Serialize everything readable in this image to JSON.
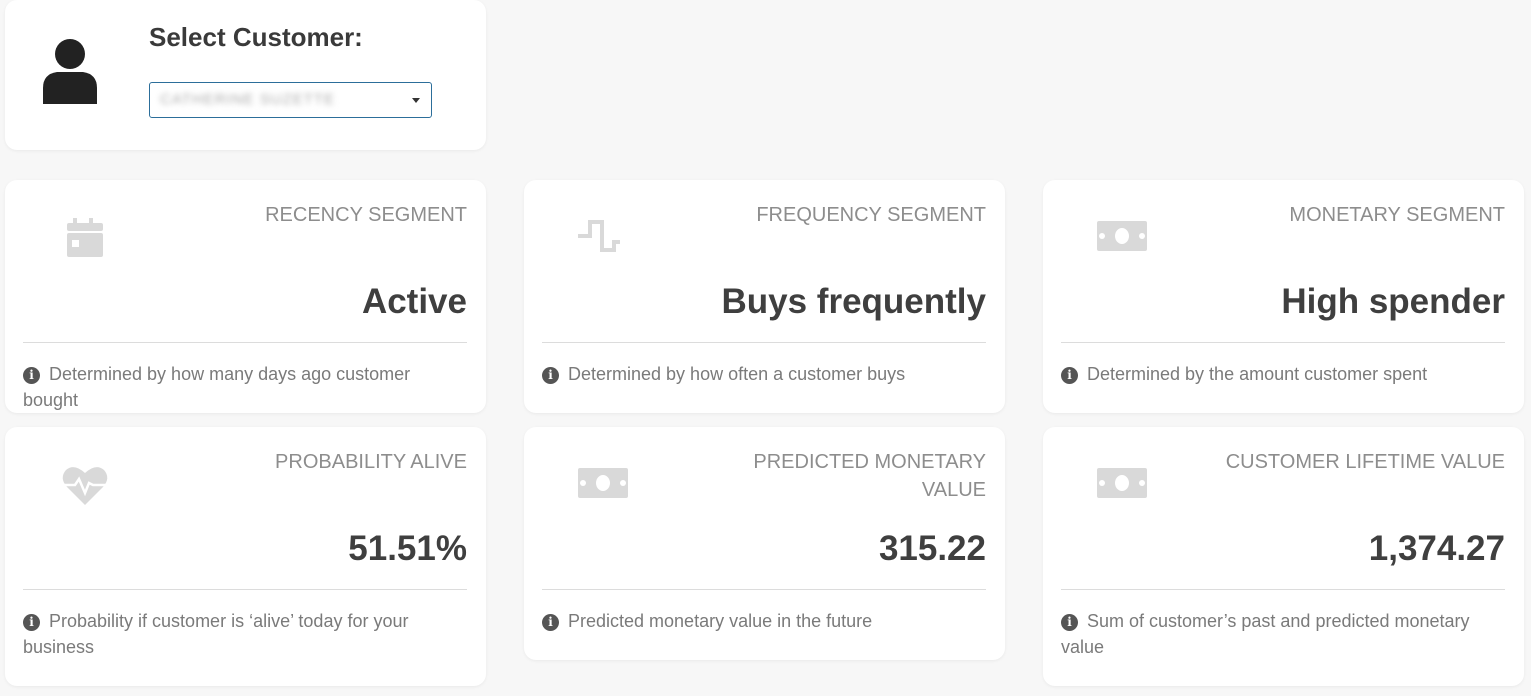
{
  "customer": {
    "label": "Select Customer:",
    "selected_value": "CATHERINE SUZETTE",
    "icon": "user-icon"
  },
  "metrics": [
    {
      "title": "RECENCY SEGMENT",
      "value": "Active",
      "description": "Determined by how many days ago customer bought",
      "icon": "calendar-icon"
    },
    {
      "title": "FREQUENCY SEGMENT",
      "value": "Buys frequently",
      "description": "Determined by how often a customer buys",
      "icon": "wave-icon"
    },
    {
      "title": "MONETARY SEGMENT",
      "value": "High spender",
      "description": "Determined by the amount customer spent",
      "icon": "money-icon"
    },
    {
      "title": "PROBABILITY ALIVE",
      "value": "51.51%",
      "description": "Probability if customer is ‘alive’ today for your business",
      "icon": "heartbeat-icon"
    },
    {
      "title": "PREDICTED MONETARY VALUE",
      "value": "315.22",
      "description": "Predicted monetary value in the future",
      "icon": "money-icon"
    },
    {
      "title": "CUSTOMER LIFETIME VALUE",
      "value": "1,374.27",
      "description": "Sum of customer’s past and predicted monetary value",
      "icon": "money-icon"
    }
  ],
  "colors": {
    "background": "#f7f7f7",
    "card": "#ffffff",
    "icon_gray": "#d9d9d9",
    "select_border": "#2c6e9a"
  }
}
